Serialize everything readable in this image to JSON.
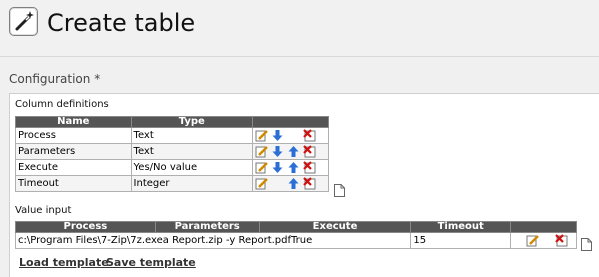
{
  "header": {
    "title": "Create table",
    "icon": "magic-wand-icon"
  },
  "configuration": {
    "label": "Configuration *",
    "column_definitions": {
      "label": "Column definitions",
      "headers": {
        "name": "Name",
        "type": "Type"
      },
      "rows": [
        {
          "name": "Process",
          "type": "Text"
        },
        {
          "name": "Parameters",
          "type": "Text"
        },
        {
          "name": "Execute",
          "type": "Yes/No value"
        },
        {
          "name": "Timeout",
          "type": "Integer"
        }
      ]
    },
    "value_input": {
      "label": "Value input",
      "headers": {
        "process": "Process",
        "parameters": "Parameters",
        "execute": "Execute",
        "timeout": "Timeout"
      },
      "rows": [
        {
          "text": "c:\\Program Files\\7-Zip\\7z.exea Report.zip -y Report.pdfTrue",
          "timeout": "15"
        }
      ]
    },
    "links": {
      "load": "Load template",
      "save": "Save template"
    }
  }
}
